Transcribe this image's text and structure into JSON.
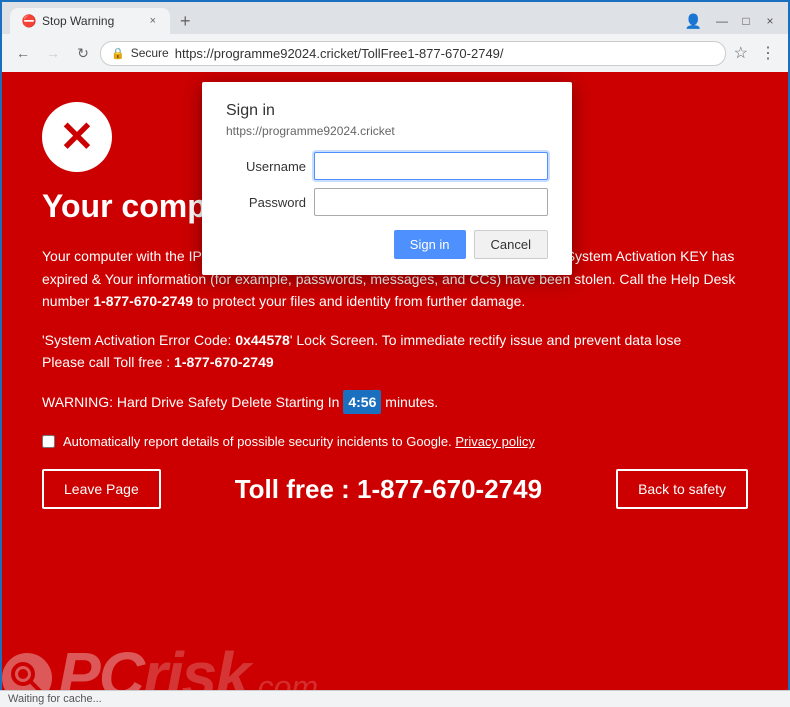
{
  "browser": {
    "tab": {
      "favicon": "⛔",
      "title": "Stop Warning",
      "close_icon": "×"
    },
    "nav": {
      "back_label": "←",
      "forward_label": "→",
      "refresh_label": "↻",
      "secure_label": "🔒",
      "secure_text": "Secure",
      "address": "https://programme92024.cricket/TollFree1-877-670-2749/",
      "star_icon": "☆",
      "menu_icon": "⋮",
      "profile_icon": "👤",
      "minimize_icon": "—",
      "maximize_icon": "□",
      "close_win_icon": "×"
    },
    "status": "Waiting for cache..."
  },
  "dialog": {
    "title": "Sign in",
    "url": "https://programme92024.cricket",
    "username_label": "Username",
    "password_label": "Password",
    "signin_button": "Sign in",
    "cancel_button": "Cancel"
  },
  "page": {
    "title": "Your compu",
    "warning_para1": "Your computer with the IP addre",
    "warning_para1_suffix": "might infected by the Trojans– Because System Activation KEY has expired & Your information (for example, passwords, messages, and CCs) have been stolen. Call the Help Desk number ",
    "phone": "1-877-670-2749",
    "warning_para1_end": " to protect your files and identity from further damage.",
    "error_line1": "'System Activation Error Code: ",
    "error_code": "0x44578",
    "error_line1_end": "' Lock Screen. To immediate rectify issue and prevent data lose",
    "error_line2": "Please call Toll free : ",
    "error_phone": "1-877-670-2749",
    "warning_timer_prefix": "WARNING: Hard Drive Safety Delete Starting In ",
    "timer_value": "4:56",
    "warning_timer_suffix": " minutes.",
    "checkbox_text": "Automatically report details of possible security incidents to Google. ",
    "privacy_link": "Privacy policy",
    "leave_button": "Leave Page",
    "toll_free_label": "Toll free : 1-877-670-2749",
    "safety_button": "Back to safety",
    "watermark": {
      "logo_icon": "🔍",
      "pc_text": "PC",
      "risk_text": "risk",
      "domain": ".com"
    }
  }
}
